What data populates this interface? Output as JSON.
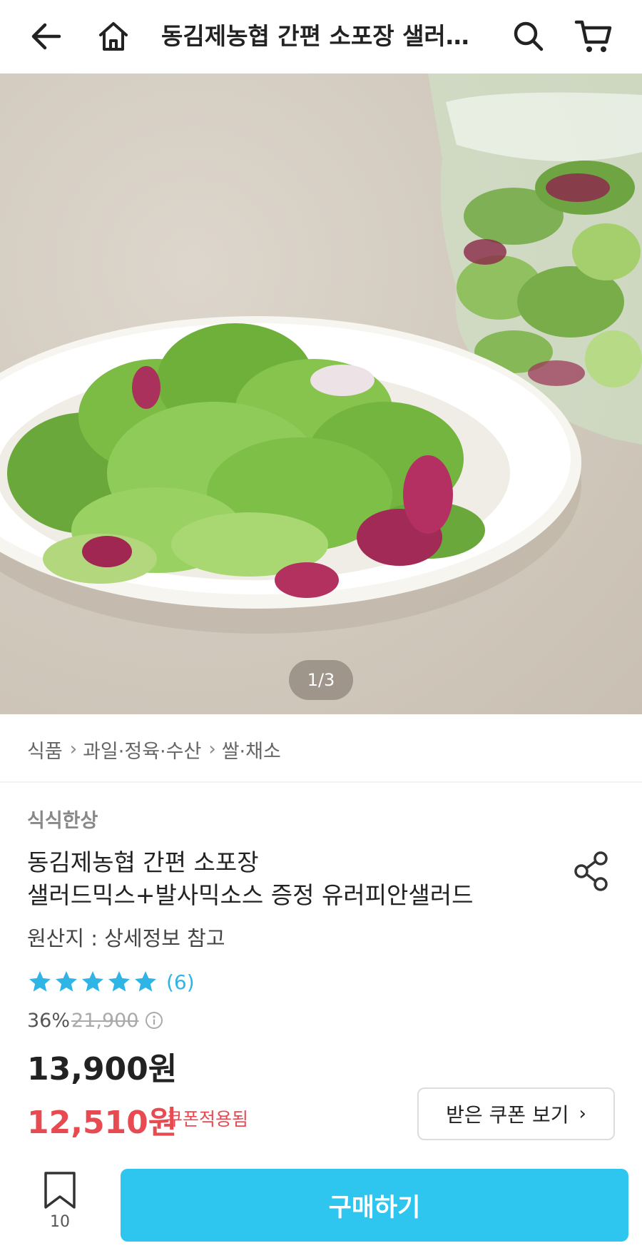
{
  "header": {
    "title": "동김제농협 간편 소포장 샐러드믹스+발사믹소스 증정 유러피안샐러드",
    "icons": {
      "back": "back-arrow-icon",
      "home": "home-icon",
      "search": "search-icon",
      "cart": "cart-icon"
    }
  },
  "gallery": {
    "pager": "1/3"
  },
  "breadcrumb": [
    "식품",
    "과일·정육·수산",
    "쌀·채소"
  ],
  "product": {
    "seller": "식식한상",
    "title_line1": "동김제농협 간편 소포장",
    "title_line2": "샐러드믹스+발사믹소스 증정 유러피안샐러드",
    "origin": "원산지 : 상세정보 참고",
    "rating": {
      "stars": 5,
      "count_text": "(6)"
    },
    "discount_rate": "36%",
    "original_price": "21,900",
    "price": "13,900원",
    "coupon_price": "12,510원",
    "coupon_applied": "쿠폰적용됨",
    "coupon_button": "받은 쿠폰 보기"
  },
  "bottom": {
    "wish_count": "10",
    "buy_label": "구매하기"
  },
  "colors": {
    "accent": "#2ec5ef",
    "star": "#2fb4e6",
    "sale": "#e84a52"
  }
}
